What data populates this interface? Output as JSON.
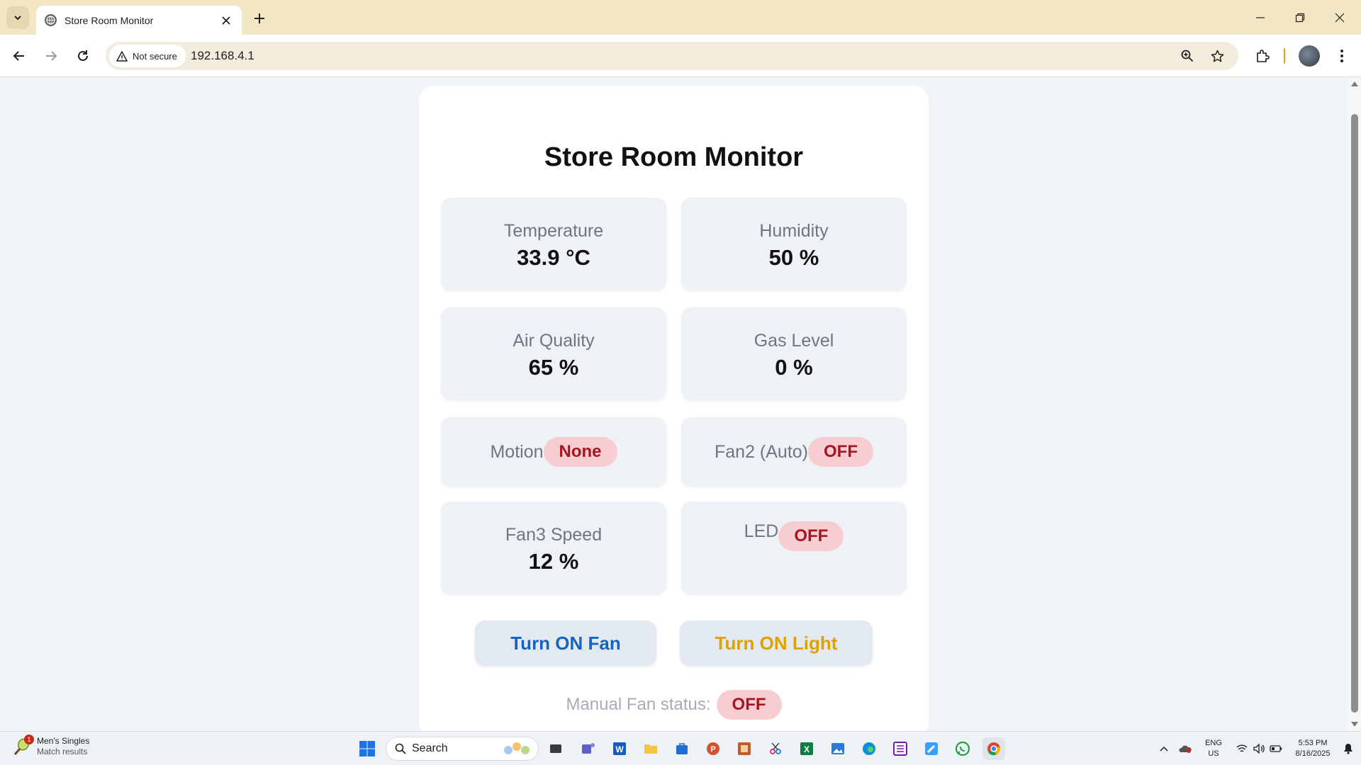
{
  "browser": {
    "tab_title": "Store Room Monitor",
    "security_label": "Not secure",
    "url": "192.168.4.1",
    "accent": "#e0a800"
  },
  "page": {
    "title": "Store Room Monitor",
    "temperature": {
      "label": "Temperature",
      "value": "33.9 °C"
    },
    "humidity": {
      "label": "Humidity",
      "value": "50 %"
    },
    "air_quality": {
      "label": "Air Quality",
      "value": "65 %"
    },
    "gas_level": {
      "label": "Gas Level",
      "value": "0 %"
    },
    "motion": {
      "label": "Motion",
      "status": "None"
    },
    "fan2": {
      "label": "Fan2 (Auto)",
      "status": "OFF"
    },
    "fan3": {
      "label": "Fan3 Speed",
      "value": "12 %"
    },
    "led": {
      "label": "LED",
      "status": "OFF"
    },
    "fan_button": "Turn ON Fan",
    "light_button": "Turn ON Light",
    "manual_fan": {
      "label": "Manual Fan status:",
      "status": "OFF"
    },
    "colors": {
      "badge_bg": "#f8cdd2",
      "badge_text": "#a31622",
      "fan_button_text": "#1565c0",
      "light_button_text": "#e0a000"
    }
  },
  "taskbar": {
    "widget_title": "Men's Singles",
    "widget_subtitle": "Match results",
    "widget_badge": "1",
    "search_label": "Search",
    "language": "ENG",
    "region": "US",
    "time": "5:53 PM",
    "date": "8/16/2025"
  }
}
